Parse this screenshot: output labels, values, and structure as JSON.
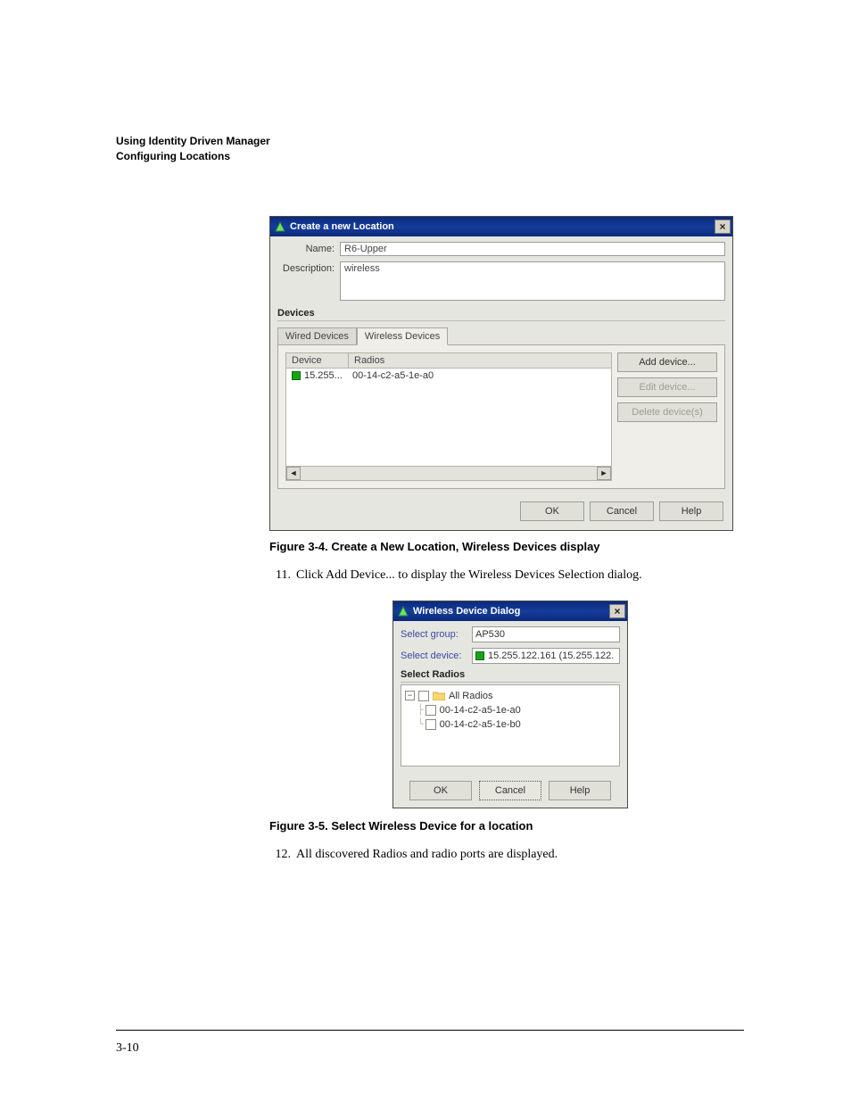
{
  "header": {
    "line1": "Using Identity Driven Manager",
    "line2": "Configuring Locations"
  },
  "dlg1": {
    "title": "Create a new Location",
    "name_label": "Name:",
    "name_value": "R6-Upper",
    "desc_label": "Description:",
    "desc_value": "wireless",
    "devices_hdr": "Devices",
    "tab_wired": "Wired Devices",
    "tab_wireless": "Wireless Devices",
    "col_device": "Device",
    "col_radios": "Radios",
    "row_device": "15.255...",
    "row_radios": "00-14-c2-a5-1e-a0",
    "btn_add": "Add device...",
    "btn_edit": "Edit device...",
    "btn_delete": "Delete device(s)",
    "btn_ok": "OK",
    "btn_cancel": "Cancel",
    "btn_help": "Help"
  },
  "caption1": "Figure 3-4. Create a New Location, Wireless Devices display",
  "step11_num": "11.",
  "step11_text": "Click Add Device... to display the Wireless Devices Selection dialog.",
  "dlg2": {
    "title": "Wireless Device Dialog",
    "sel_group_label": "Select group:",
    "sel_group_value": "AP530",
    "sel_device_label": "Select device:",
    "sel_device_value": "15.255.122.161 (15.255.122.",
    "sel_radios_hdr": "Select Radios",
    "tree_root": "All Radios",
    "tree_child1": "00-14-c2-a5-1e-a0",
    "tree_child2": "00-14-c2-a5-1e-b0",
    "btn_ok": "OK",
    "btn_cancel": "Cancel",
    "btn_help": "Help"
  },
  "caption2": "Figure 3-5. Select Wireless Device for a location",
  "step12_num": "12.",
  "step12_text": "All discovered Radios and radio ports are displayed.",
  "pagenum": "3-10"
}
